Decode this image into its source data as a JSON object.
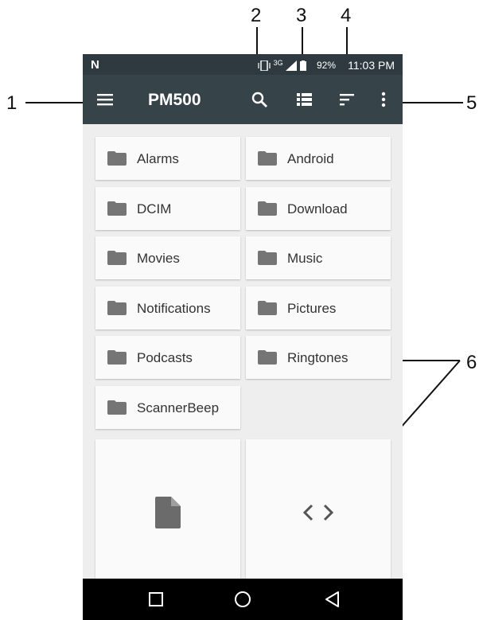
{
  "callouts": [
    "1",
    "2",
    "3",
    "4",
    "5",
    "6"
  ],
  "status_bar": {
    "network": "3G",
    "battery": "92%",
    "time": "11:03 PM"
  },
  "toolbar": {
    "title": "PM500",
    "icons": [
      "menu-icon",
      "search-icon",
      "list-view-icon",
      "sort-icon",
      "more-vert-icon"
    ]
  },
  "folders": [
    {
      "label": "Alarms"
    },
    {
      "label": "Android"
    },
    {
      "label": "DCIM"
    },
    {
      "label": "Download"
    },
    {
      "label": "Movies"
    },
    {
      "label": "Music"
    },
    {
      "label": "Notifications"
    },
    {
      "label": "Pictures"
    },
    {
      "label": "Podcasts"
    },
    {
      "label": "Ringtones"
    },
    {
      "label": "ScannerBeep"
    }
  ],
  "file_cards": [
    {
      "icon": "document-icon"
    },
    {
      "icon": "code-icon"
    }
  ],
  "nav_bar": [
    "recent-apps-icon",
    "home-icon",
    "back-icon"
  ],
  "colors": {
    "toolbar": "#364449",
    "status_bar": "#2e3a40",
    "background": "#eeeeee",
    "folder_icon": "#757575"
  }
}
